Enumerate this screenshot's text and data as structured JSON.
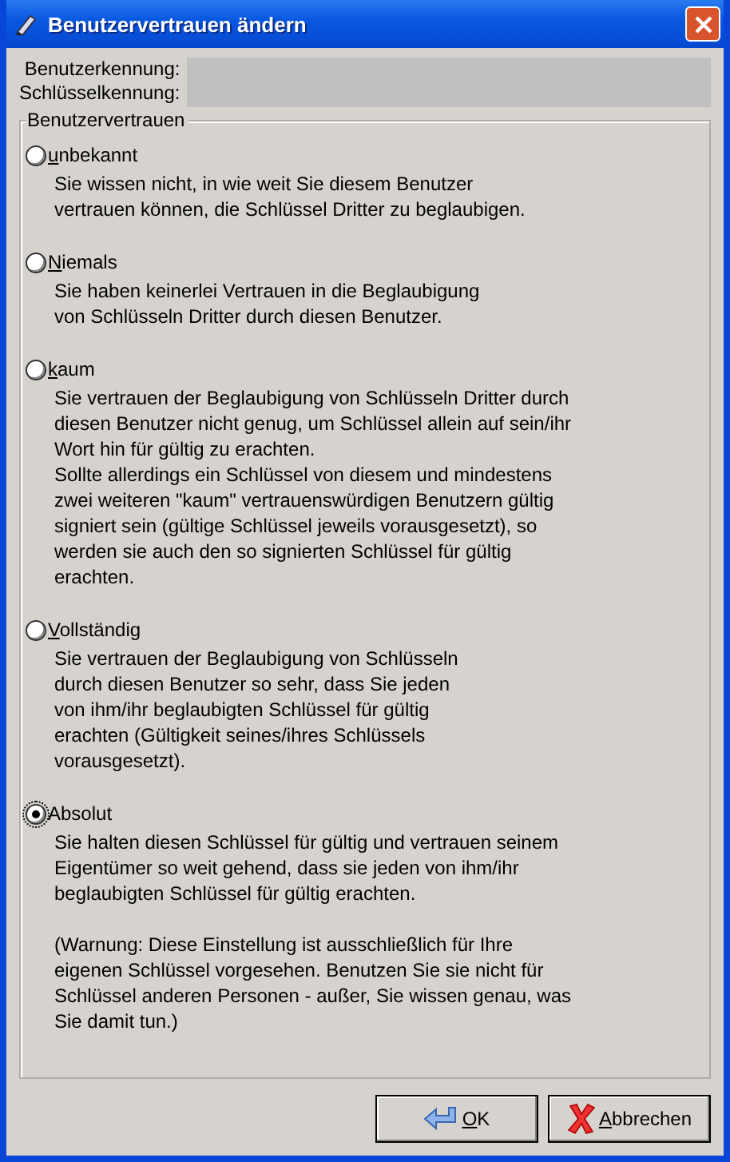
{
  "window": {
    "title": "Benutzervertrauen ändern"
  },
  "fields": [
    {
      "label": "Benutzerkennung:"
    },
    {
      "label": "Schlüsselkennung:"
    }
  ],
  "trust_group": {
    "title": "Benutzervertrauen",
    "options": [
      {
        "label": "unbekannt",
        "underline_first": true,
        "selected": false,
        "paragraphs": [
          "Sie wissen nicht, in wie weit Sie diesem Benutzer\nvertrauen können, die Schlüssel Dritter zu beglaubigen."
        ]
      },
      {
        "label": "Niemals",
        "underline_first": true,
        "selected": false,
        "paragraphs": [
          "Sie haben keinerlei Vertrauen in die Beglaubigung\nvon Schlüsseln Dritter durch diesen Benutzer."
        ]
      },
      {
        "label": "kaum",
        "underline_first": true,
        "selected": false,
        "paragraphs": [
          "Sie vertrauen der Beglaubigung von Schlüsseln Dritter durch\ndiesen Benutzer nicht genug,  um Schlüssel allein auf sein/ihr\nWort hin für gültig zu erachten.\nSollte allerdings ein Schlüssel von diesem und mindestens\nzwei weiteren \"kaum\" vertrauenswürdigen Benutzern gültig\nsigniert sein (gültige Schlüssel jeweils vorausgesetzt), so\nwerden sie auch den so signierten Schlüssel für gültig\nerachten."
        ]
      },
      {
        "label": "Vollständig",
        "underline_first": true,
        "selected": false,
        "paragraphs": [
          "Sie vertrauen der Beglaubigung von Schlüsseln\ndurch diesen Benutzer so sehr, dass Sie jeden\nvon ihm/ihr beglaubigten Schlüssel für gültig\nerachten (Gültigkeit seines/ihres Schlüssels\nvorausgesetzt)."
        ]
      },
      {
        "label": "Absolut",
        "underline_first": false,
        "selected": true,
        "paragraphs": [
          "Sie halten diesen Schlüssel für gültig und vertrauen seinem\nEigentümer so weit gehend, dass sie jeden von ihm/ihr\nbeglaubigten Schlüssel für gültig erachten.",
          "(Warnung: Diese Einstellung ist ausschließlich für Ihre\neigenen Schlüssel vorgesehen. Benutzen Sie sie nicht für\nSchlüssel anderen Personen - außer, Sie wissen genau, was\nSie damit tun.)"
        ]
      }
    ]
  },
  "buttons": [
    {
      "kind": "ok",
      "label": "OK"
    },
    {
      "kind": "cancel",
      "label": "Abbrechen"
    }
  ]
}
